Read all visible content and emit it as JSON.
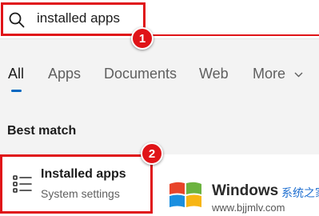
{
  "search": {
    "value": "installed apps",
    "icon": "search-icon"
  },
  "tabs": [
    {
      "label": "All",
      "active": true
    },
    {
      "label": "Apps",
      "active": false
    },
    {
      "label": "Documents",
      "active": false
    },
    {
      "label": "Web",
      "active": false
    },
    {
      "label": "More",
      "active": false
    }
  ],
  "best_match": {
    "heading": "Best match",
    "result": {
      "title": "Installed apps",
      "subtitle": "System settings",
      "icon": "list-settings-icon"
    }
  },
  "annotations": {
    "step1": "1",
    "step2": "2",
    "color": "#e01418"
  },
  "watermark": {
    "brand": "Windows",
    "cn": "系统之家",
    "url": "www.bjjmlv.com"
  },
  "colors": {
    "accent": "#0067c0",
    "background": "#f3f3f3"
  }
}
